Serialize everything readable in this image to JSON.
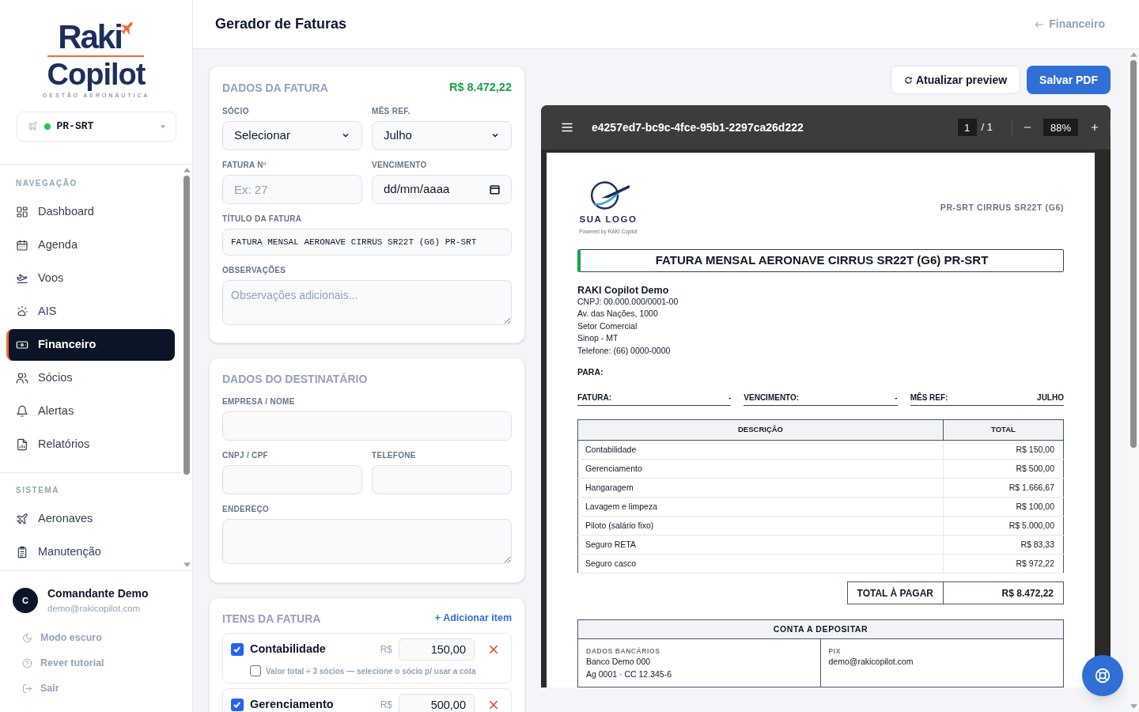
{
  "sidebar": {
    "logo": {
      "brand": "Raki",
      "product": "Copilot",
      "tagline": "GESTÃO AERONÁUTICA"
    },
    "aircraft_selector": {
      "value": "PR-SRT",
      "online": true
    },
    "nav_sections": [
      {
        "title": "NAVEGAÇÃO",
        "items": [
          {
            "label": "Dashboard",
            "selected": false
          },
          {
            "label": "Agenda",
            "selected": false
          },
          {
            "label": "Voos",
            "selected": false
          },
          {
            "label": "AIS",
            "selected": false
          },
          {
            "label": "Financeiro",
            "selected": true
          },
          {
            "label": "Sócios",
            "selected": false
          },
          {
            "label": "Alertas",
            "selected": false
          },
          {
            "label": "Relatórios",
            "selected": false
          }
        ]
      },
      {
        "title": "SISTEMA",
        "items": [
          {
            "label": "Aeronaves",
            "selected": false
          },
          {
            "label": "Manutenção",
            "selected": false
          }
        ]
      }
    ],
    "user": {
      "initial": "C",
      "name": "Comandante Demo",
      "email": "demo@rakicopilot.com"
    },
    "footer_links": [
      "Modo escuro",
      "Rever tutorial",
      "Sair"
    ]
  },
  "header": {
    "title": "Gerador de Faturas",
    "back_link": "Financeiro"
  },
  "invoice_card": {
    "title": "DADOS DA FATURA",
    "total": "R$ 8.472,22",
    "socio": {
      "label": "SÓCIO",
      "value": "Selecionar"
    },
    "mes_ref": {
      "label": "MÊS REF.",
      "value": "Julho"
    },
    "numero": {
      "label": "FATURA Nº",
      "placeholder": "Ex: 27"
    },
    "vencimento": {
      "label": "VENCIMENTO",
      "value": "dd/mm/aaaa"
    },
    "titulo": {
      "label": "TÍTULO DA FATURA",
      "value": "FATURA MENSAL AERONAVE CIRRUS SR22T (G6) PR-SRT"
    },
    "observacoes": {
      "label": "OBSERVAÇÕES",
      "placeholder": "Observações adicionais..."
    }
  },
  "recipient_card": {
    "title": "DADOS DO DESTINATÁRIO",
    "empresa": {
      "label": "EMPRESA / NOME"
    },
    "cnpj": {
      "label": "CNPJ / CPF"
    },
    "telefone": {
      "label": "TELEFONE"
    },
    "endereco": {
      "label": "ENDEREÇO"
    }
  },
  "items_card": {
    "title": "ITENS DA FATURA",
    "add_link": "+ Adicionar item",
    "items": [
      {
        "checked": true,
        "label": "Contabilidade",
        "currency": "R$",
        "amount": "150,00",
        "note": {
          "checked": false,
          "text": "Valor total ÷ 3 sócios — selecione o sócio p/ usar a cota"
        }
      },
      {
        "checked": true,
        "label": "Gerenciamento",
        "currency": "R$",
        "amount": "500,00"
      }
    ]
  },
  "actions": {
    "refresh": "Atualizar preview",
    "save": "Salvar PDF"
  },
  "pdf_viewer": {
    "filename": "e4257ed7-bc9c-4fce-95b1-2297ca26d222",
    "page": "1",
    "page_total": "/ 1",
    "zoom": "88%",
    "document": {
      "logo_text": "SUA LOGO",
      "powered_by": "Powered by RAKI Copilot",
      "aircraft": "PR-SRT CIRRUS SR22T (G6)",
      "title": "FATURA MENSAL AERONAVE CIRRUS SR22T (G6) PR-SRT",
      "issuer": {
        "name": "RAKI Copilot Demo",
        "lines": [
          "CNPJ: 00.000.000/0001-00",
          "Av. das Nações, 1000",
          "Setor Comercial",
          "Sinop - MT",
          "Telefone: (66) 0000-0000"
        ]
      },
      "to_label": "PARA:",
      "meta": [
        {
          "label": "FATURA:",
          "value": "-"
        },
        {
          "label": "VENCIMENTO:",
          "value": "-"
        },
        {
          "label": "MÊS REF:",
          "value": "JULHO"
        }
      ],
      "table": {
        "columns": [
          "DESCRIÇÃO",
          "TOTAL"
        ],
        "rows": [
          {
            "description": "Contabilidade",
            "total": "R$ 150,00"
          },
          {
            "description": "Gerenciamento",
            "total": "R$ 500,00"
          },
          {
            "description": "Hangaragem",
            "total": "R$ 1.666,67"
          },
          {
            "description": "Lavagem e limpeza",
            "total": "R$ 100,00"
          },
          {
            "description": "Piloto (salário fixo)",
            "total": "R$ 5.000,00"
          },
          {
            "description": "Seguro RETA",
            "total": "R$ 83,33"
          },
          {
            "description": "Seguro casco",
            "total": "R$ 972,22"
          }
        ]
      },
      "total": {
        "label": "TOTAL À PAGAR",
        "value": "R$ 8.472,22"
      },
      "deposit": {
        "title": "CONTA A DEPOSITAR",
        "bank": {
          "label": "DADOS BANCÁRIOS",
          "lines": [
            "Banco Demo 000",
            "Ag 0001 · CC 12.345-6"
          ]
        },
        "pix": {
          "label": "PIX",
          "value": "demo@rakicopilot.com"
        }
      }
    }
  }
}
